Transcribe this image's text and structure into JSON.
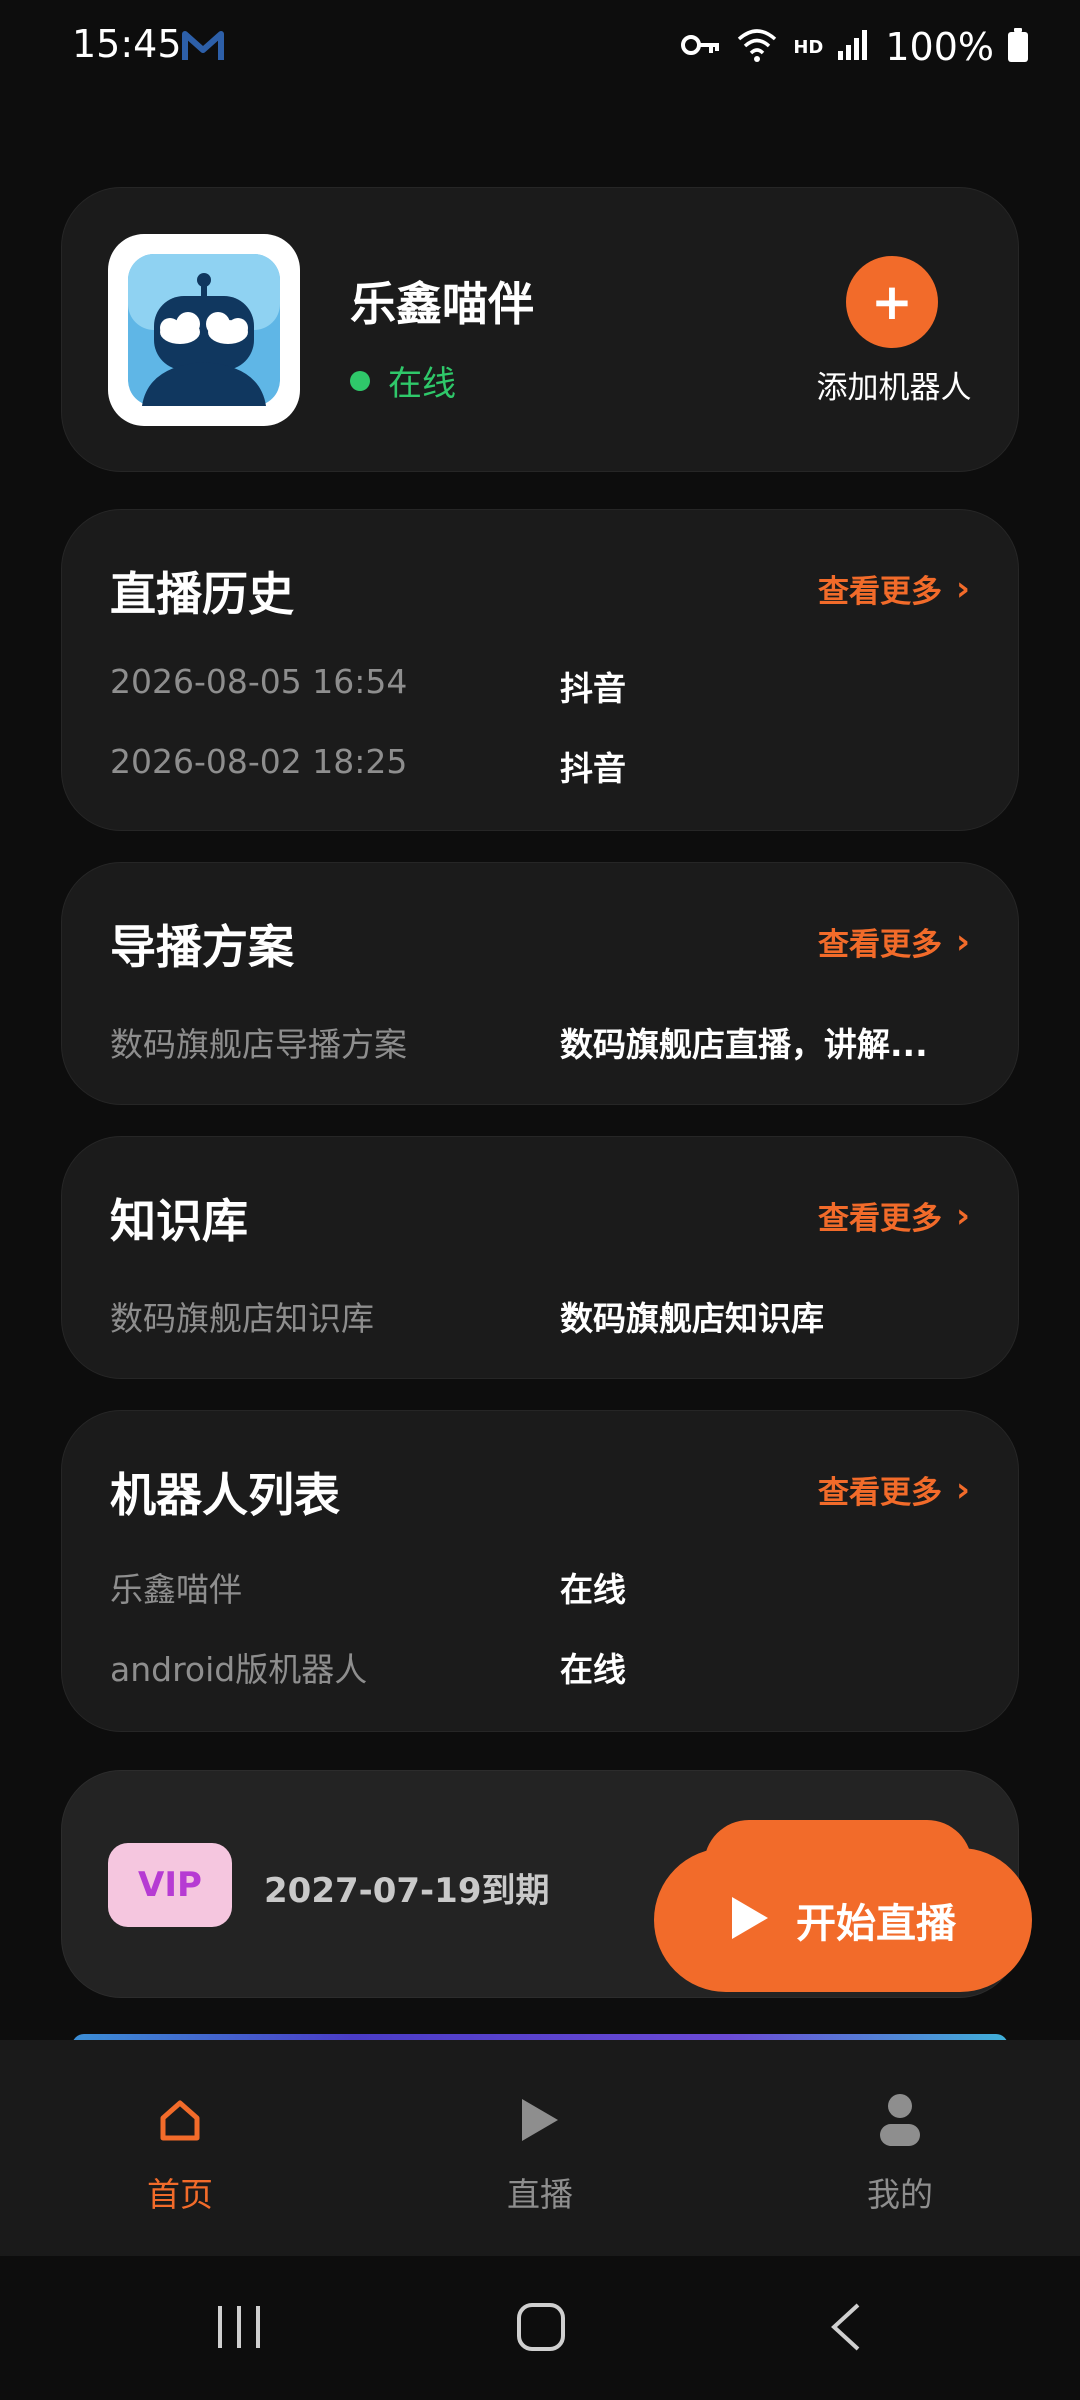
{
  "status_bar": {
    "time": "15:45",
    "battery_percent": "100%",
    "network_label": "HD",
    "icons": [
      "app-notification-icon",
      "vpn-key-icon",
      "wifi-icon",
      "signal-icon",
      "battery-icon"
    ]
  },
  "profile": {
    "bot_name": "乐鑫喵伴",
    "status": "在线",
    "add_label": "添加机器人",
    "status_color": "#2fc86a"
  },
  "common": {
    "more_label": "查看更多"
  },
  "live_history": {
    "title": "直播历史",
    "rows": [
      {
        "time": "2026-08-05 16:54",
        "platform": "抖音"
      },
      {
        "time": "2026-08-02 18:25",
        "platform": "抖音"
      }
    ]
  },
  "director_plan": {
    "title": "导播方案",
    "rows": [
      {
        "name": "数码旗舰店导播方案",
        "desc": "数码旗舰店直播，讲解..."
      }
    ]
  },
  "knowledge_base": {
    "title": "知识库",
    "rows": [
      {
        "name": "数码旗舰店知识库",
        "value": "数码旗舰店知识库"
      }
    ]
  },
  "robot_list": {
    "title": "机器人列表",
    "rows": [
      {
        "name": "乐鑫喵伴",
        "status": "在线"
      },
      {
        "name": "android版机器人",
        "status": "在线"
      }
    ]
  },
  "vip": {
    "badge": "VIP",
    "expiry": "2027-07-19到期"
  },
  "start_live": {
    "label": "开始直播"
  },
  "tabs": [
    {
      "label": "首页",
      "icon": "home-icon",
      "active": true
    },
    {
      "label": "直播",
      "icon": "play-icon",
      "active": false
    },
    {
      "label": "我的",
      "icon": "person-icon",
      "active": false
    }
  ],
  "colors": {
    "accent": "#f26b2a",
    "background": "#0d0d0d",
    "card": "#1b1b1b",
    "online": "#2fc86a"
  }
}
